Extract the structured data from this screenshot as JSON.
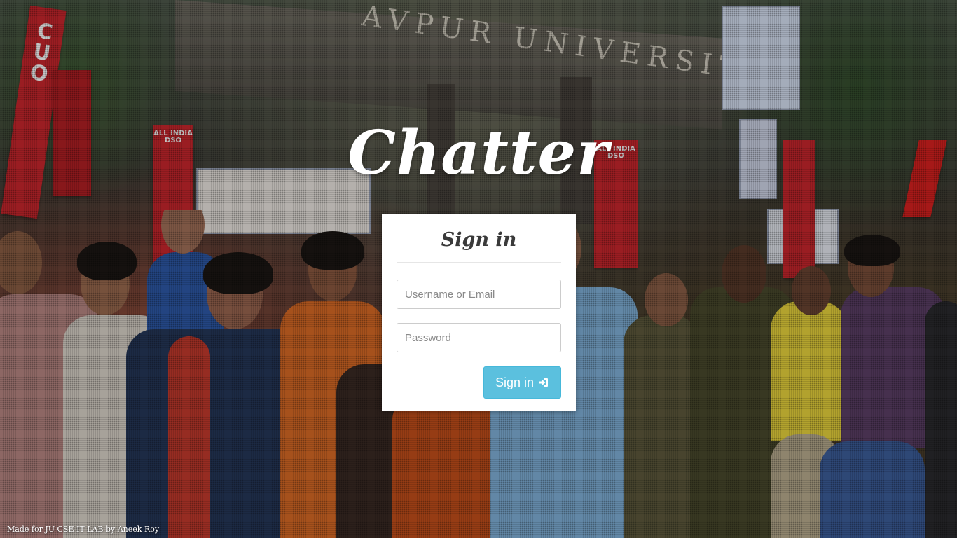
{
  "background": {
    "gate_text": "AVPUR UNIVERSITY",
    "banners": {
      "all_india_dso_1": "ALL INDIA\nDSO",
      "all_india_dso_2": "ALL INDIA\nDSO"
    }
  },
  "brand": {
    "title": "Chatter"
  },
  "login_card": {
    "heading": "Sign in",
    "username_placeholder": "Username or Email",
    "password_placeholder": "Password",
    "submit_label": "Sign in",
    "submit_icon": "sign-in-icon"
  },
  "footer": {
    "credit": "Made for JU CSE IT LAB by Aneek Roy"
  },
  "colors": {
    "button": "#5bc0de",
    "card": "#ffffff",
    "banner": "#c8262c"
  }
}
